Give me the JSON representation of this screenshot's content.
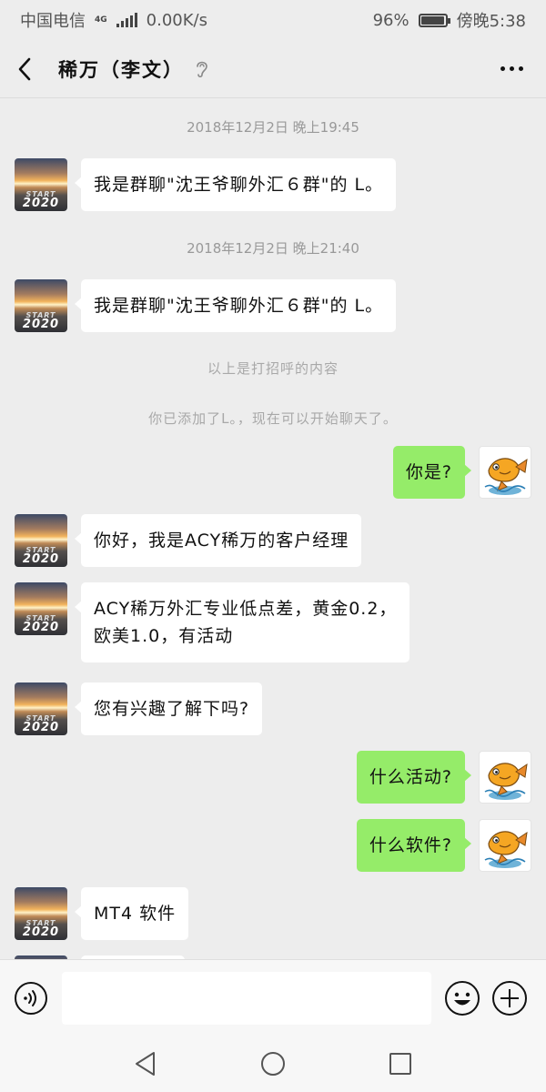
{
  "status_bar": {
    "carrier": "中国电信",
    "network": "4G",
    "speed": "0.00K/s",
    "battery": "96%",
    "battery_level": 0.96,
    "time": "傍晚5:38"
  },
  "header": {
    "title": "稀万（李文）",
    "back_icon": "chevron-left-icon",
    "ear_icon": "ear-icon",
    "more_icon": "more-dots-icon"
  },
  "messages": {
    "t1": "2018年12月2日 晚上19:45",
    "m1": "我是群聊\"沈王爷聊外汇６群\"的 L。",
    "t2": "2018年12月2日 晚上21:40",
    "m2": "我是群聊\"沈王爷聊外汇６群\"的 L。",
    "sys1": "以上是打招呼的内容",
    "sys2": "你已添加了L。，现在可以开始聊天了。",
    "m3": "你是?",
    "m4": "你好，我是ACY稀万的客户经理",
    "m5_line1": "ACY稀万外汇专业低点差，黄金0.2，",
    "m5_line2": "欧美1.0，有活动",
    "m6": "您有兴趣了解下吗?",
    "m7": "什么活动?",
    "m8": "什么软件?",
    "m9": "MT4 软件"
  },
  "avatars": {
    "other_text_small": "START",
    "other_text_big": "2020"
  },
  "input_bar": {
    "voice_icon": "voice-icon",
    "emoji_icon": "emoji-icon",
    "plus_icon": "plus-icon",
    "placeholder": ""
  },
  "nav_bar": {
    "back": "triangle-back-icon",
    "home": "circle-home-icon",
    "recent": "square-recent-icon"
  },
  "colors": {
    "background": "#ededed",
    "my_bubble": "#95ec69",
    "their_bubble": "#ffffff"
  }
}
